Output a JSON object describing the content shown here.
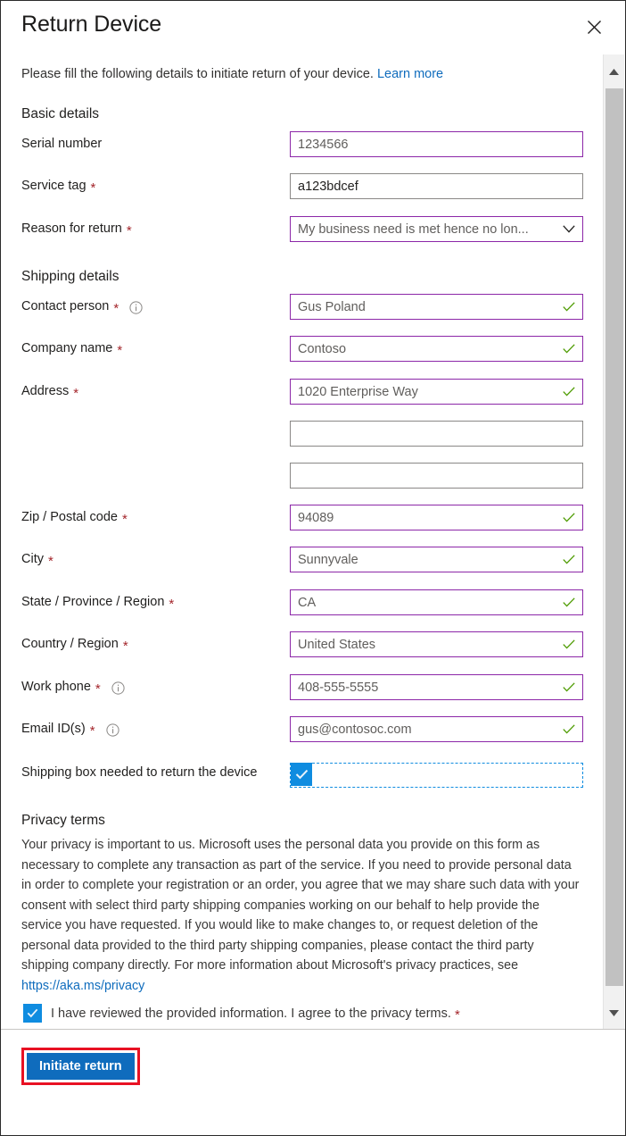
{
  "panel": {
    "title": "Return Device",
    "close_icon": "close-icon",
    "intro_text": "Please fill the following details to initiate return of your device.",
    "intro_link": "Learn more"
  },
  "basic_details": {
    "heading": "Basic details",
    "fields": [
      {
        "label": "Serial number",
        "required": false,
        "info": false,
        "value": "1234566",
        "type": "text",
        "border": "purple",
        "validated": false,
        "value_tone": "muted"
      },
      {
        "label": "Service tag",
        "required": true,
        "info": false,
        "value": "a123bdcef",
        "type": "text",
        "border": "gray",
        "validated": false,
        "value_tone": "dark"
      },
      {
        "label": "Reason for return",
        "required": true,
        "info": false,
        "value": "My business need is met hence no lon...",
        "type": "dropdown",
        "border": "purple",
        "validated": false,
        "value_tone": "muted"
      }
    ]
  },
  "shipping_details": {
    "heading": "Shipping details",
    "fields": [
      {
        "label": "Contact person",
        "required": true,
        "info": true,
        "value": "Gus Poland",
        "type": "text",
        "border": "purple",
        "validated": true,
        "value_tone": "muted"
      },
      {
        "label": "Company name",
        "required": true,
        "info": false,
        "value": "Contoso",
        "type": "text",
        "border": "purple",
        "validated": true,
        "value_tone": "muted"
      },
      {
        "label": "Address",
        "required": true,
        "info": false,
        "value": "1020 Enterprise Way",
        "type": "text",
        "border": "purple",
        "validated": true,
        "value_tone": "muted"
      },
      {
        "label": "",
        "required": false,
        "info": false,
        "value": "",
        "type": "text",
        "border": "gray",
        "validated": false,
        "value_tone": "muted"
      },
      {
        "label": "",
        "required": false,
        "info": false,
        "value": "",
        "type": "text",
        "border": "gray",
        "validated": false,
        "value_tone": "muted"
      },
      {
        "label": "Zip / Postal code",
        "required": true,
        "info": false,
        "value": "94089",
        "type": "text",
        "border": "purple",
        "validated": true,
        "value_tone": "muted"
      },
      {
        "label": "City",
        "required": true,
        "info": false,
        "value": "Sunnyvale",
        "type": "text",
        "border": "purple",
        "validated": true,
        "value_tone": "muted"
      },
      {
        "label": "State / Province / Region",
        "required": true,
        "info": false,
        "value": "CA",
        "type": "text",
        "border": "purple",
        "validated": true,
        "value_tone": "muted"
      },
      {
        "label": "Country / Region",
        "required": true,
        "info": false,
        "value": "United States",
        "type": "text",
        "border": "purple",
        "validated": true,
        "value_tone": "muted"
      },
      {
        "label": "Work phone",
        "required": true,
        "info": true,
        "value": "408-555-5555",
        "type": "text",
        "border": "purple",
        "validated": true,
        "value_tone": "muted"
      },
      {
        "label": "Email ID(s)",
        "required": true,
        "info": true,
        "value": "gus@contosoc.com",
        "type": "text",
        "border": "purple",
        "validated": true,
        "value_tone": "muted"
      }
    ],
    "shipping_box": {
      "label": "Shipping box needed to return the device",
      "checked": true
    }
  },
  "privacy": {
    "heading": "Privacy terms",
    "body": "Your privacy is important to us. Microsoft uses the personal data you provide on this form as necessary to complete any transaction as part of the service. If you need to provide personal data in order to complete your registration or an order, you agree that we may share such data with your consent with select third party shipping companies working on our behalf to help provide the service you have requested. If you would like to make changes to, or request deletion of the personal data provided to the third party shipping companies, please contact the third party shipping company directly. For more information about Microsoft's privacy practices, see ",
    "link": "https://aka.ms/privacy",
    "agree_label": "I have reviewed the provided information. I agree to the privacy terms.",
    "agree_checked": true,
    "agree_required": true
  },
  "footer": {
    "primary_button": "Initiate return"
  },
  "scrollbar": {
    "up_arrow": "chevron-up-icon",
    "down_arrow": "chevron-down-icon"
  },
  "colors": {
    "accent": "#0f6cbd",
    "checkbox": "#0f8ce0",
    "field_active": "#8c27a8",
    "field_default": "#8a8886",
    "required": "#a4262c",
    "valid": "#4d9b00",
    "highlight": "#e81123",
    "link": "#0f6cbd"
  }
}
